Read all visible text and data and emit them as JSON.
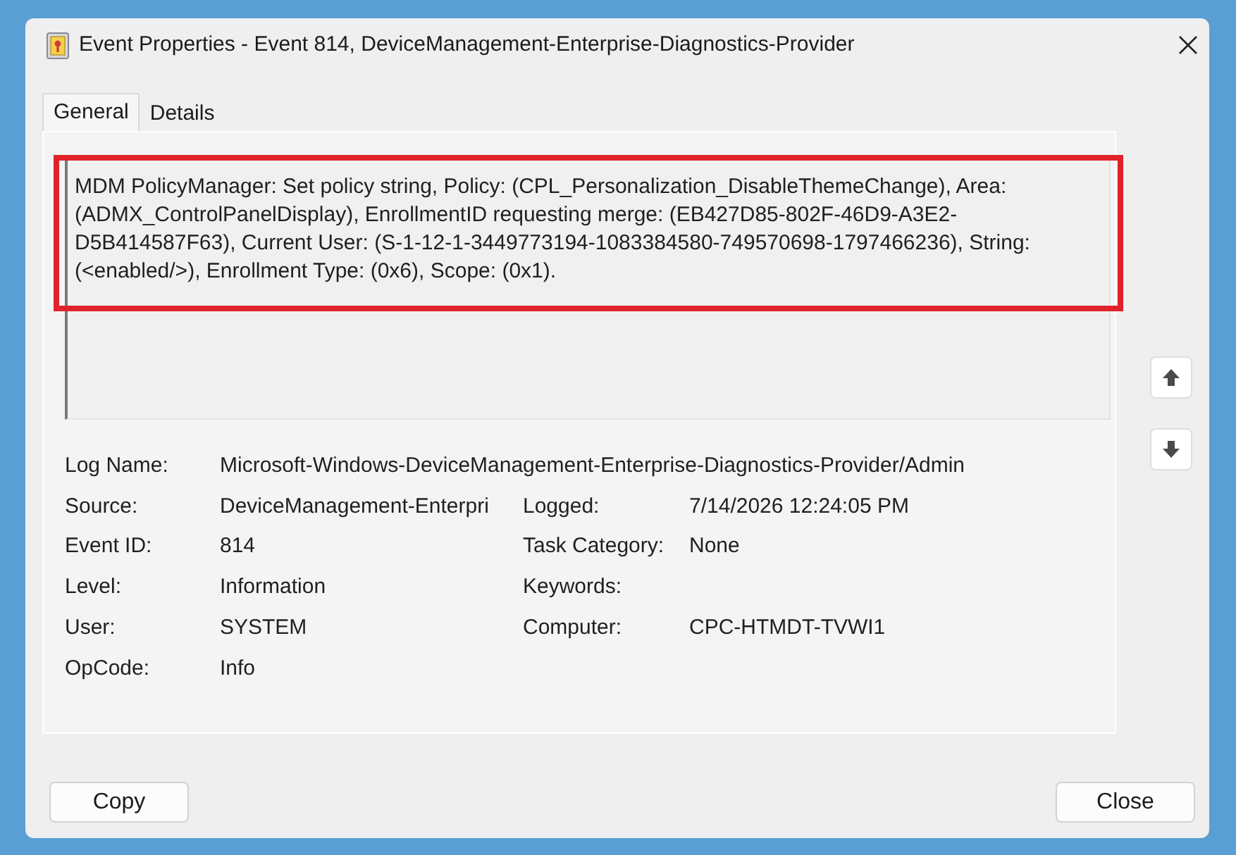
{
  "window": {
    "title": "Event Properties - Event 814, DeviceManagement-Enterprise-Diagnostics-Provider"
  },
  "tabs": [
    {
      "label": "General",
      "selected": true
    },
    {
      "label": "Details",
      "selected": false
    }
  ],
  "description": {
    "text": "MDM PolicyManager: Set policy string, Policy: (CPL_Personalization_DisableThemeChange), Area: (ADMX_ControlPanelDisplay), EnrollmentID requesting merge: (EB427D85-802F-46D9-A3E2-D5B414587F63), Current User: (S-1-12-1-3449773194-1083384580-749570698-1797466236), String: (<enabled/>), Enrollment Type: (0x6), Scope: (0x1).",
    "highlighted": true
  },
  "nav_buttons": [
    {
      "kind": "up"
    },
    {
      "kind": "down"
    }
  ],
  "fields": [
    {
      "pairs": [
        {
          "label": "Log Name:",
          "value": "Microsoft-Windows-DeviceManagement-Enterprise-Diagnostics-Provider/Admin"
        }
      ]
    },
    {
      "pairs": [
        {
          "label": "Source:",
          "value": "DeviceManagement-Enterpri"
        },
        {
          "label": "Logged:",
          "value": "7/14/2026 12:24:05 PM"
        }
      ]
    },
    {
      "pairs": [
        {
          "label": "Event ID:",
          "value": "814"
        },
        {
          "label": "Task Category:",
          "value": "None"
        }
      ]
    },
    {
      "pairs": [
        {
          "label": "Level:",
          "value": "Information"
        },
        {
          "label": "Keywords:"
        }
      ]
    },
    {
      "pairs": [
        {
          "label": "User:",
          "value": "SYSTEM"
        },
        {
          "label": "Computer:",
          "value": "CPC-HTMDT-TVWI1"
        }
      ]
    },
    {
      "pairs": [
        {
          "label": "OpCode:",
          "value": "Info"
        }
      ]
    }
  ],
  "buttons": [
    {
      "label": "Copy"
    },
    {
      "label": "Close"
    }
  ]
}
